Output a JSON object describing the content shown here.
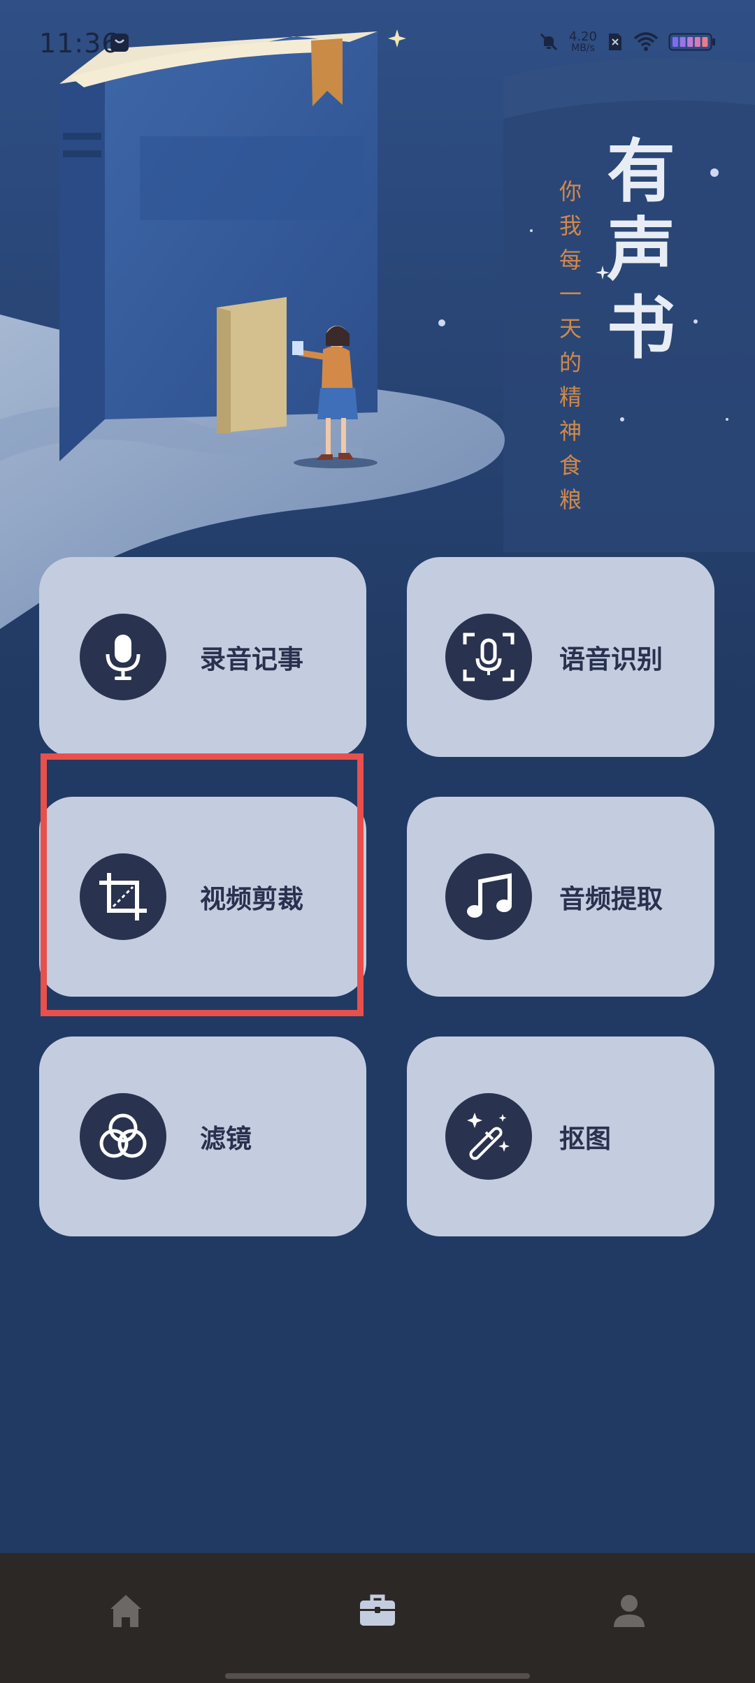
{
  "status_bar": {
    "time": "11:36",
    "net_speed_value": "4.20",
    "net_speed_unit": "MB/s",
    "battery_colors": [
      "#7b6cf0",
      "#9a74e8",
      "#c07ad8",
      "#dc7ab2",
      "#ea7c8a"
    ]
  },
  "hero": {
    "title": [
      "有",
      "声",
      "书"
    ],
    "subtitle": [
      "你",
      "我",
      "每",
      "一",
      "天",
      "的",
      "精",
      "神",
      "食",
      "粮"
    ]
  },
  "tools": [
    {
      "label": "录音记事",
      "icon": "microphone-icon"
    },
    {
      "label": "语音识别",
      "icon": "voice-recognition-icon"
    },
    {
      "label": "视频剪裁",
      "icon": "crop-icon"
    },
    {
      "label": "音频提取",
      "icon": "music-note-icon"
    },
    {
      "label": "滤镜",
      "icon": "filter-icon"
    },
    {
      "label": "抠图",
      "icon": "magic-wand-icon"
    }
  ],
  "bottom_nav": [
    {
      "icon": "home-icon",
      "active": false
    },
    {
      "icon": "toolbox-icon",
      "active": true
    },
    {
      "icon": "profile-icon",
      "active": false
    }
  ],
  "colors": {
    "background": "#213a63",
    "card": "#c4cde0",
    "icon_circle": "#29324e",
    "highlight": "#e8504c",
    "subtitle": "#d0894a",
    "nav_bar": "#2c2826"
  }
}
